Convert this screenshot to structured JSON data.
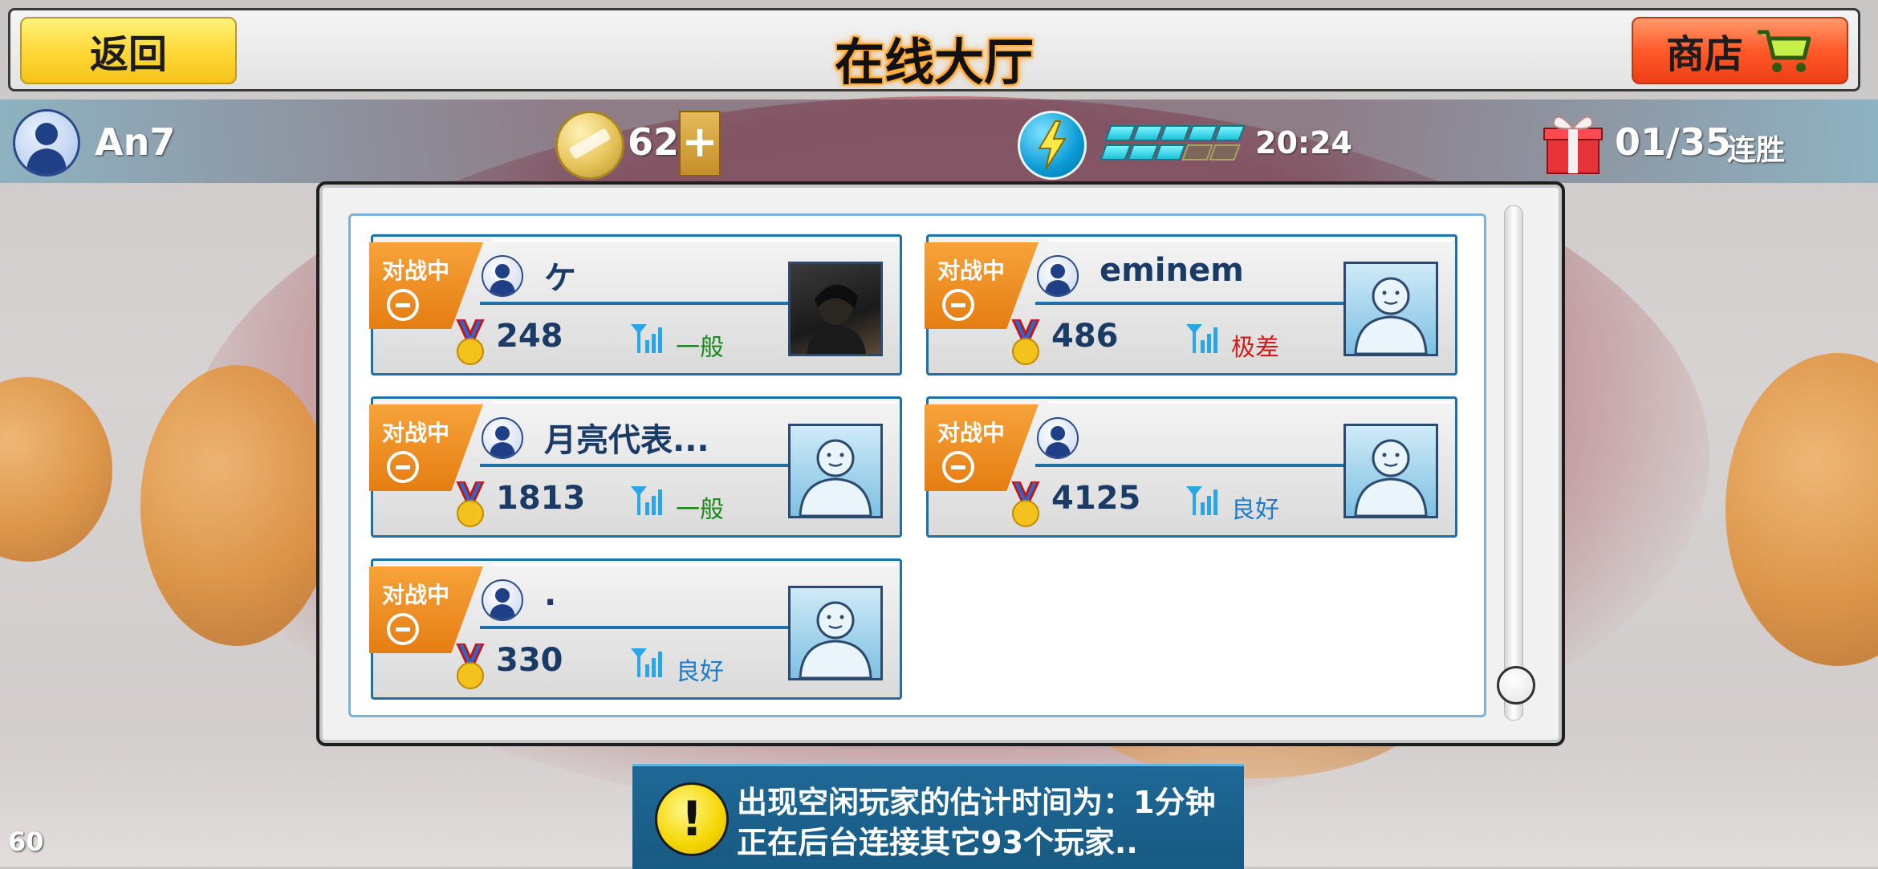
{
  "header": {
    "back_label": "返回",
    "title": "在线大厅",
    "shop_label": "商店"
  },
  "status": {
    "username": "An7",
    "coins": "62",
    "add_label": "+",
    "energy_timer": "20:24",
    "energy_level": 0.7,
    "win_streak": "01/35",
    "win_streak_label": "连胜"
  },
  "players": [
    {
      "tab": "对战中",
      "name": "ケ",
      "score": "248",
      "signal": "一般",
      "signal_color": "#1a8a1a",
      "photo": true
    },
    {
      "tab": "对战中",
      "name": "eminem",
      "score": "486",
      "signal": "极差",
      "signal_color": "#d01b1b",
      "photo": false
    },
    {
      "tab": "对战中",
      "name": "月亮代表...",
      "score": "1813",
      "signal": "一般",
      "signal_color": "#1a8a1a",
      "photo": false
    },
    {
      "tab": "对战中",
      "name": "",
      "score": "4125",
      "signal": "良好",
      "signal_color": "#1b7cc9",
      "photo": false
    },
    {
      "tab": "对战中",
      "name": ".",
      "score": "330",
      "signal": "良好",
      "signal_color": "#1b7cc9",
      "photo": false
    }
  ],
  "banner": {
    "line1": "出现空闲玩家的估计时间为：1分钟",
    "line2": "正在后台连接其它93个玩家..",
    "icon_text": "!"
  },
  "fps": "60",
  "colors": {
    "accent_blue": "#1f6fa8",
    "tab_orange": "#e57d12",
    "back_yellow": "#ffd93a",
    "shop_red": "#ff5a2a"
  }
}
